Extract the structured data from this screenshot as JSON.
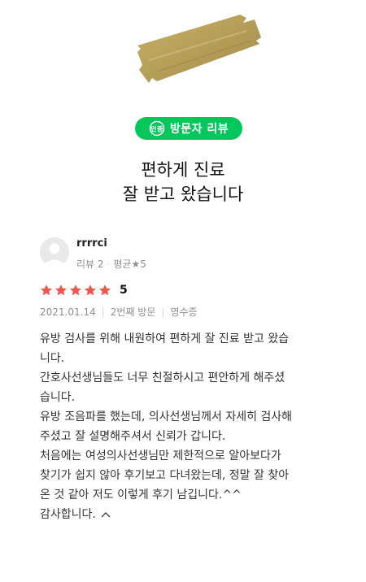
{
  "badge": {
    "label": "방문자 리뷰",
    "icon": "certified-icon",
    "color": "#03c75a"
  },
  "headline": {
    "lines": [
      "편하게 진료",
      "잘 받고 왔습니다"
    ]
  },
  "reviewer": {
    "username": "rrrrci",
    "review_label": "리뷰 2",
    "average_label": "평균★5",
    "avatar_icon": "default-avatar-icon"
  },
  "rating": {
    "stars": 5,
    "score": "5",
    "star_color": "#f05650"
  },
  "meta": {
    "date": "2021.01.14",
    "visit": "2번째 방문",
    "receipt": "영수증"
  },
  "review": {
    "lines": [
      "유방 검사를 위해 내원하여 편하게 잘 진료 받고 왔습",
      "니다.",
      "간호사선생님들도 너무 친절하시고 편안하게 해주셨",
      "습니다.",
      "유방 조음파를 했는데, 의사선생님께서 자세히 검사해",
      "주셨고 잘 설명해주셔서 신뢰가 갑니다.",
      "처음에는 여성의사선생님만 제한적으로 알아보다가",
      "찾기가 쉽지 않아 후기보고 다녀왔는데, 정말 잘 찾아",
      "온 것 같아 저도 이렇게 후기 남깁니다.^^",
      "감사합니다."
    ],
    "collapse_icon": "chevron-up-icon"
  }
}
